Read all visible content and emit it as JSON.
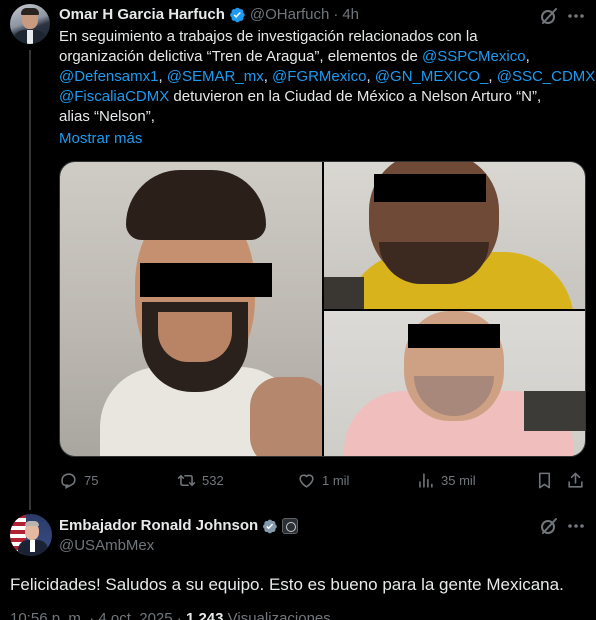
{
  "tweet1": {
    "author_name": "Omar H Garcia Harfuch",
    "handle": "@OHarfuch",
    "separator": "·",
    "time": "4h",
    "text_lines": [
      [
        {
          "t": "En seguimiento a trabajos de investigación relacionados con la",
          "link": false
        }
      ],
      [
        {
          "t": "organización delictiva “Tren de Aragua”, elementos de ",
          "link": false
        },
        {
          "t": "@SSPCMexico",
          "link": true
        },
        {
          "t": ",",
          "link": false
        }
      ],
      [
        {
          "t": "@Defensamx1",
          "link": true
        },
        {
          "t": ", ",
          "link": false
        },
        {
          "t": "@SEMAR_mx",
          "link": true
        },
        {
          "t": ", ",
          "link": false
        },
        {
          "t": "@FGRMexico",
          "link": true
        },
        {
          "t": ", ",
          "link": false
        },
        {
          "t": "@GN_MEXICO_",
          "link": true
        },
        {
          "t": ", ",
          "link": false
        },
        {
          "t": "@SSC_CDMX",
          "link": true
        },
        {
          "t": " y",
          "link": false
        }
      ],
      [
        {
          "t": "@FiscaliaCDMX",
          "link": true
        },
        {
          "t": " detuvieron en la Ciudad de México a Nelson Arturo “N”,",
          "link": false
        }
      ],
      [
        {
          "t": "alias “Nelson”,",
          "link": false
        }
      ]
    ],
    "show_more": "Mostrar más",
    "actions": {
      "replies": "75",
      "reposts": "532",
      "likes": "1 mil",
      "views": "35 mil"
    }
  },
  "tweet2": {
    "author_name": "Embajador Ronald Johnson",
    "handle": "@USAmbMex",
    "text": "Felicidades!  Saludos a su equipo. Esto es bueno para la gente Mexicana.",
    "meta_time": "10:56 p. m. · 4 oct. 2025 · ",
    "meta_views_count": "1.243",
    "meta_views_label": " Visualizaciones"
  },
  "icons": {
    "verified": "verified-badge-icon",
    "grok": "grok-icon",
    "more": "more-icon",
    "reply": "reply-icon",
    "repost": "repost-icon",
    "like": "like-icon",
    "views": "views-icon",
    "bookmark": "bookmark-icon",
    "share": "share-icon"
  },
  "colors": {
    "background": "#000000",
    "text": "#e7e9ea",
    "secondary": "#71767b",
    "link": "#1d9bf0",
    "verified_blue": "#1d9bf0",
    "gov_verified_gray": "#829aab"
  }
}
